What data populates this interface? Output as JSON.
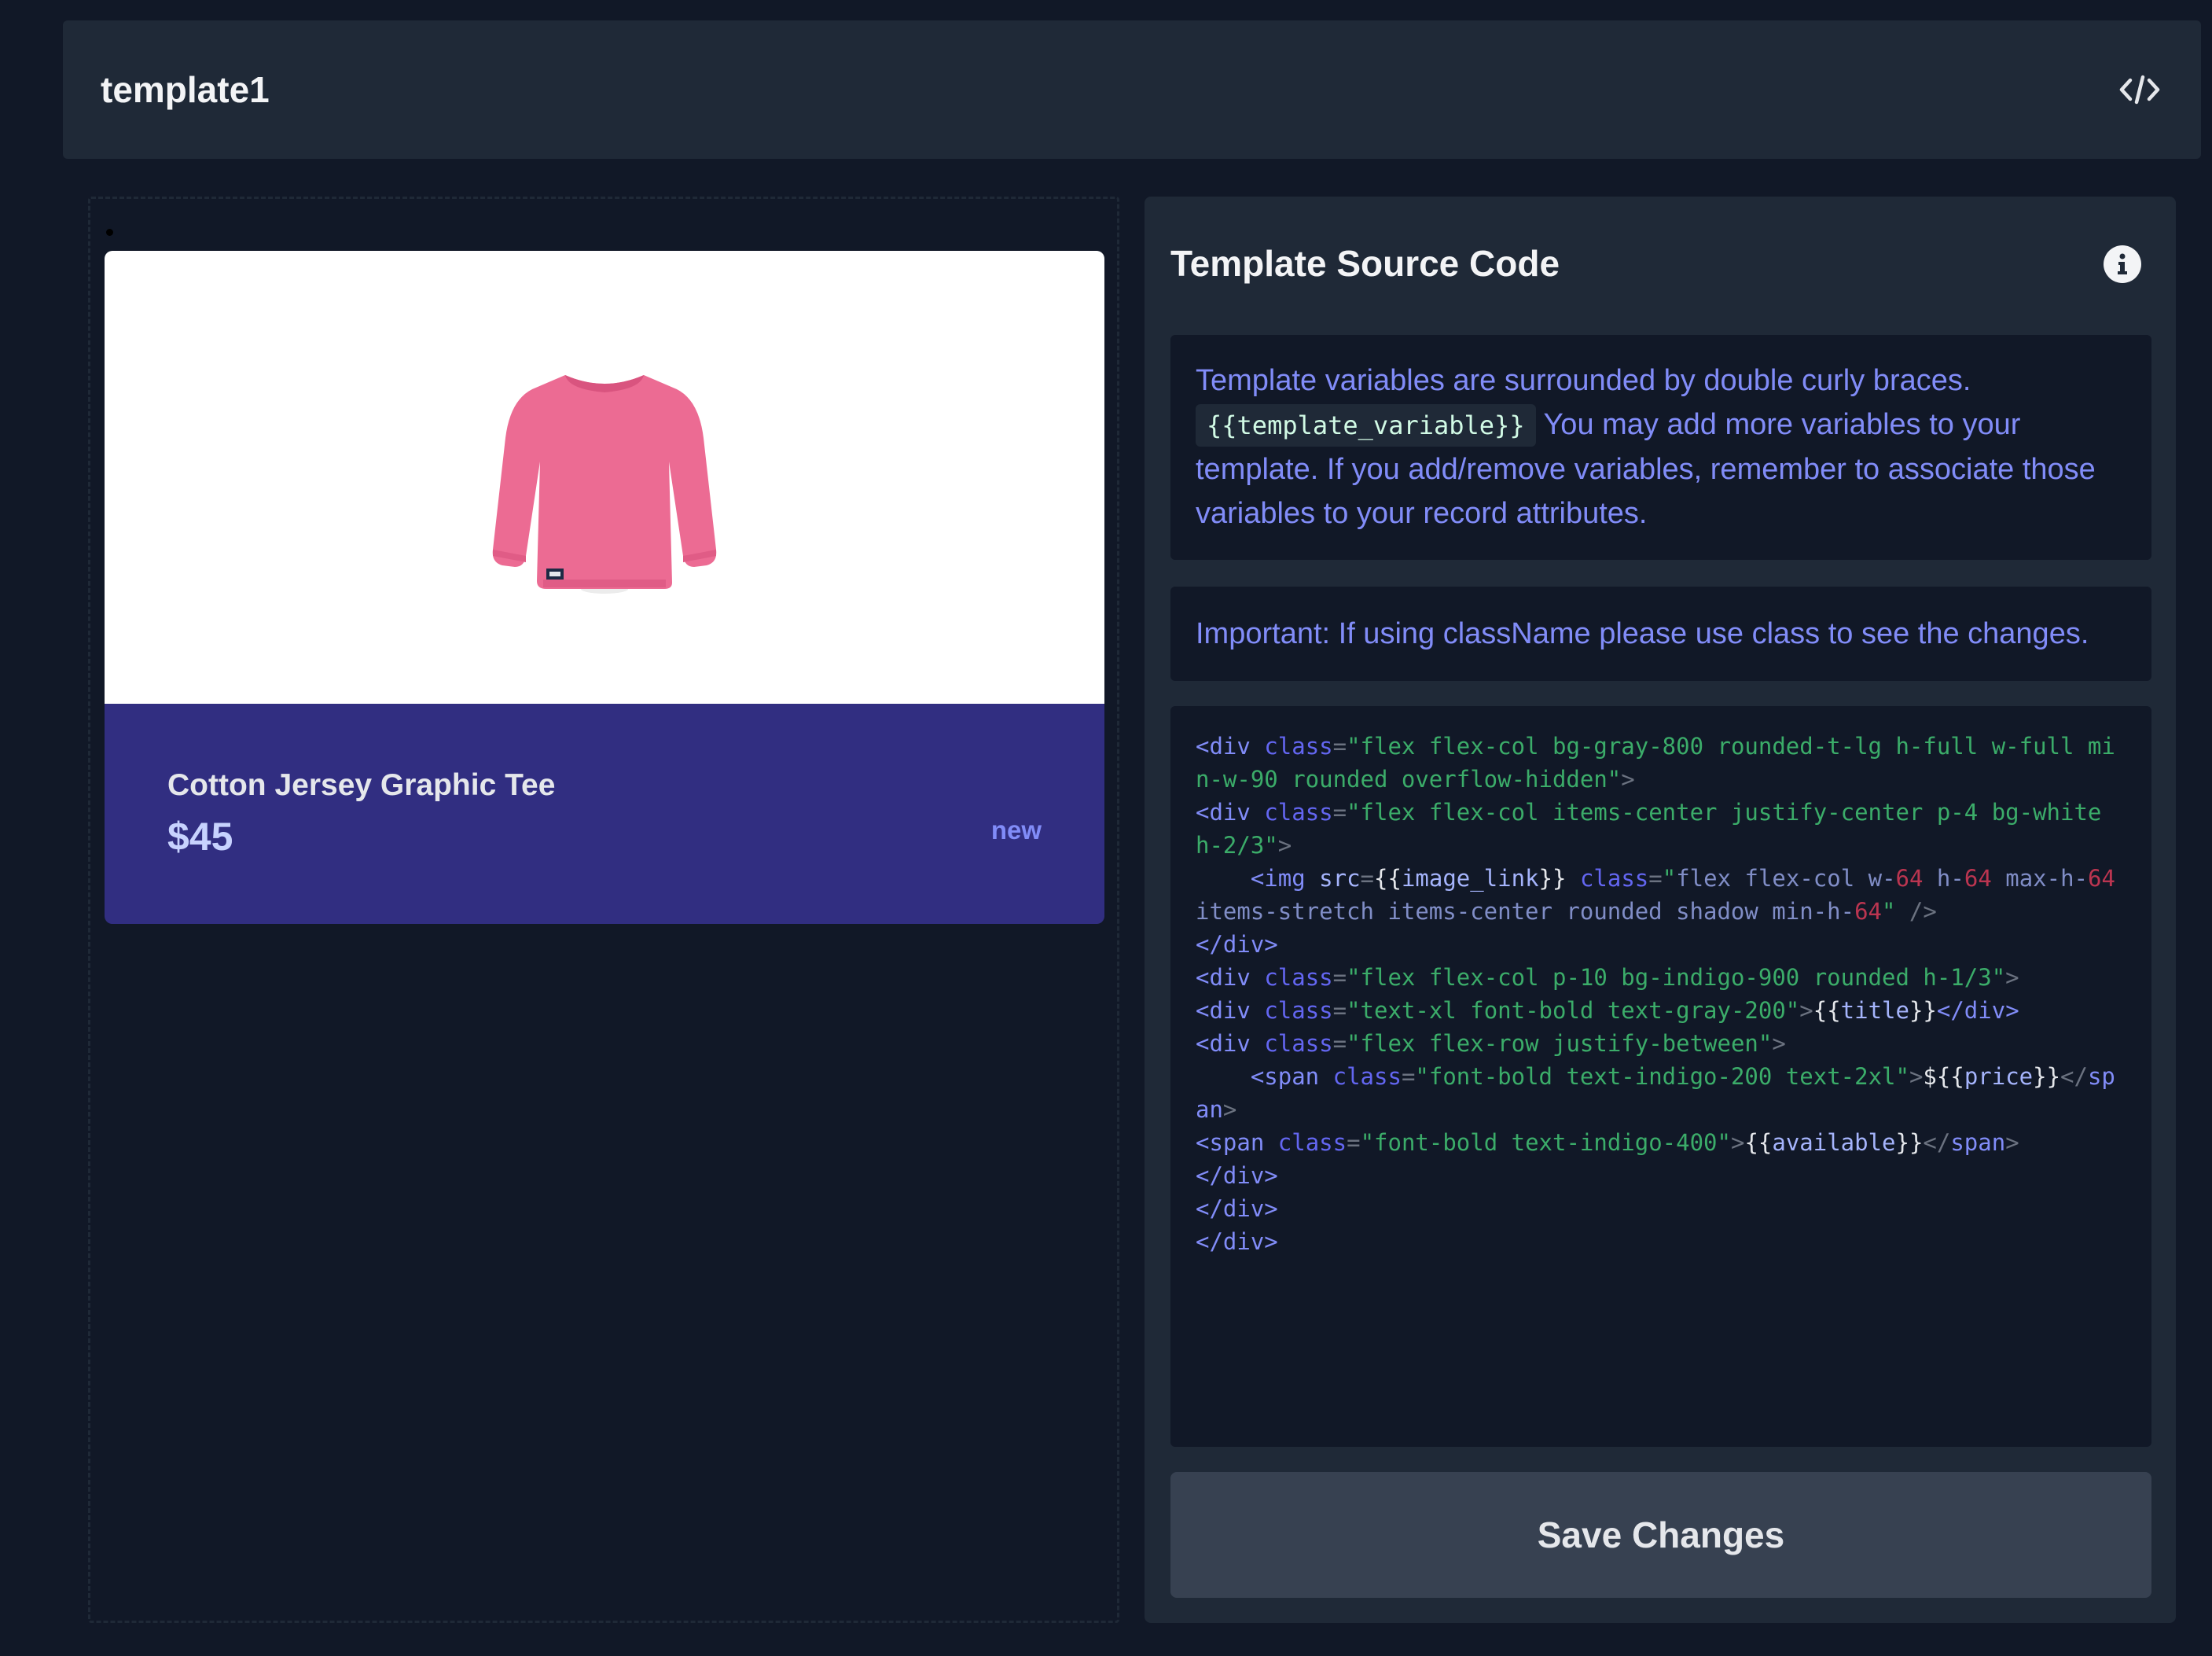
{
  "header": {
    "title": "template1",
    "code_icon": "code-brackets-icon"
  },
  "preview": {
    "card": {
      "image_alt": "Cotton Jersey Graphic Tee",
      "title": "Cotton Jersey Graphic Tee",
      "price": "$45",
      "available": "new"
    }
  },
  "panel": {
    "title": "Template Source Code",
    "info_icon": "info-icon",
    "note_intro": "Template variables are surrounded by double curly braces.",
    "note_code": "{{template_variable}}",
    "note_rest": "You may add more variables to your template. If you add/remove variables, remember to associate those variables to your record attributes.",
    "important": "Important: If using className please use class to see the changes.",
    "save_label": "Save Changes"
  },
  "colors": {
    "background": "#111827",
    "panel": "#1f2937",
    "card_body": "#312e81",
    "accent": "#818cf8",
    "button": "#374151"
  }
}
